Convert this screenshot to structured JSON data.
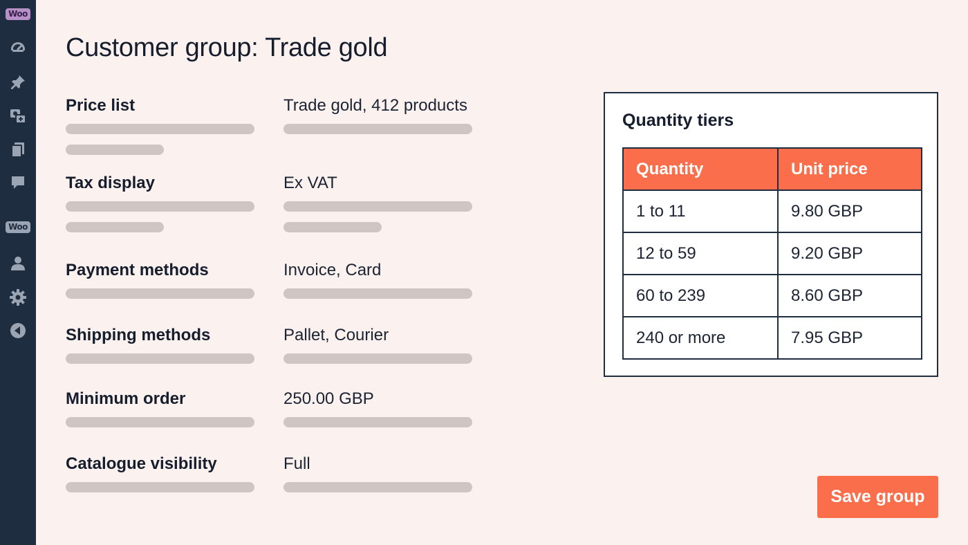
{
  "sidebar": {
    "items": [
      {
        "icon": "woo-logo-icon",
        "label": "Woo"
      },
      {
        "icon": "dashboard-gauge-icon"
      },
      {
        "icon": "pin-icon"
      },
      {
        "icon": "media-icon"
      },
      {
        "icon": "pages-icon"
      },
      {
        "icon": "comments-icon"
      },
      {
        "icon": "woocommerce-icon",
        "label": "Woo"
      },
      {
        "icon": "users-icon"
      },
      {
        "icon": "settings-gear-icon"
      },
      {
        "icon": "collapse-menu-icon"
      }
    ]
  },
  "page": {
    "title": "Customer group: Trade gold"
  },
  "fields": [
    {
      "label": "Price list",
      "value": "Trade gold, 412 products"
    },
    {
      "label": "Tax display",
      "value": "Ex VAT"
    },
    {
      "label": "Payment methods",
      "value": "Invoice, Card"
    },
    {
      "label": "Shipping methods",
      "value": "Pallet, Courier"
    },
    {
      "label": "Minimum order",
      "value": "250.00 GBP"
    },
    {
      "label": "Catalogue visibility",
      "value": "Full"
    }
  ],
  "tiers": {
    "title": "Quantity tiers",
    "headers": [
      "Quantity",
      "Unit price"
    ],
    "rows": [
      [
        "1 to 11",
        "9.80 GBP"
      ],
      [
        "12 to 59",
        "9.20 GBP"
      ],
      [
        "60 to 239",
        "8.60 GBP"
      ],
      [
        "240 or more",
        "7.95 GBP"
      ]
    ]
  },
  "actions": {
    "save_label": "Save group"
  },
  "colors": {
    "sidebar": "#1f2d40",
    "background": "#fbf1ee",
    "accent": "#fb6e4b",
    "skeleton": "#cfc5c2"
  }
}
